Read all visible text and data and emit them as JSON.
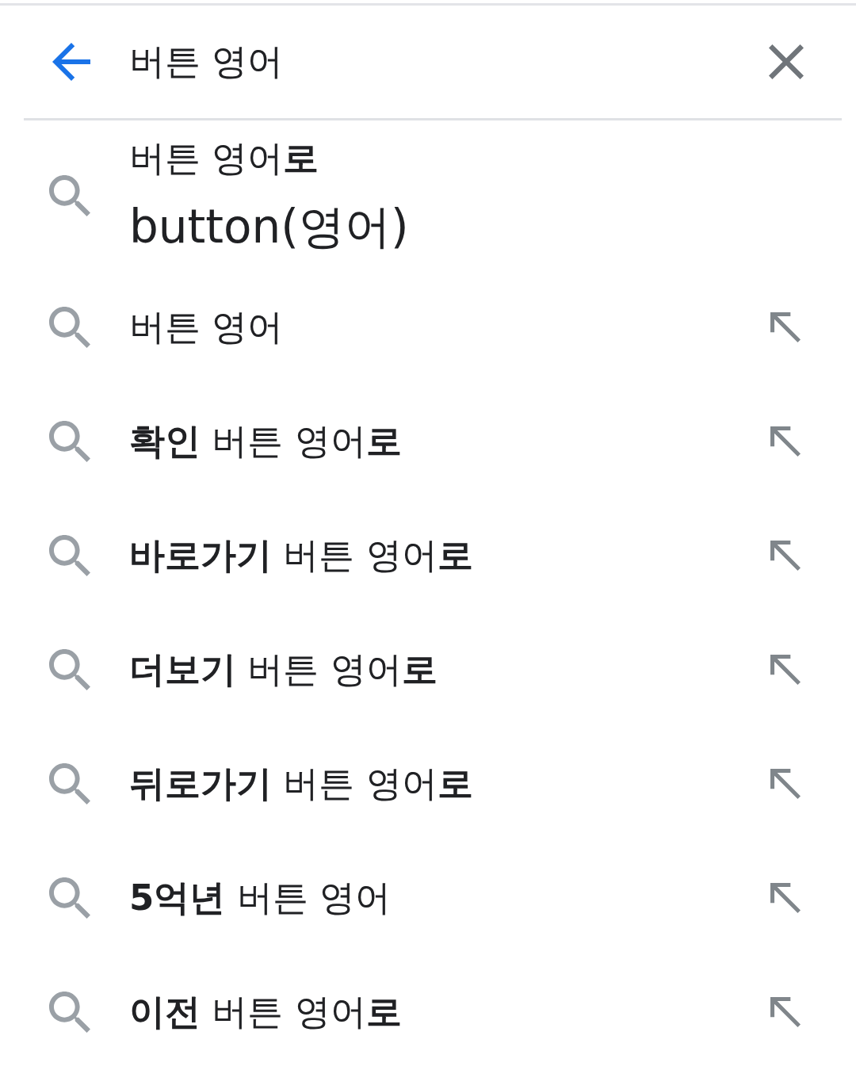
{
  "search_bar": {
    "value": "버튼 영어"
  },
  "answer": {
    "text": "버튼 영어**로**",
    "answer": "button(영어)"
  },
  "suggestions": [
    {
      "text": "버튼 영어"
    },
    {
      "text": "**확인** 버튼 영어**로**"
    },
    {
      "text": "**바로가기** 버튼 영어**로**"
    },
    {
      "text": "**더보기** 버튼 영어**로**"
    },
    {
      "text": "**뒤로가기** 버튼 영어**로**"
    },
    {
      "text": "**5억년** 버튼 영어"
    },
    {
      "text": "**이전** 버튼 영어**로**"
    }
  ]
}
